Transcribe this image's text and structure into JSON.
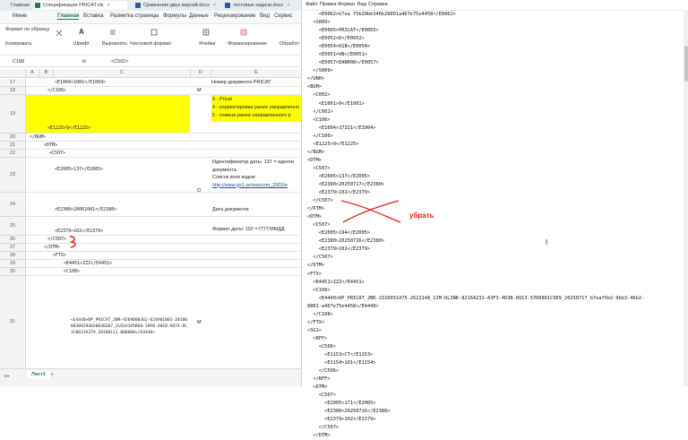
{
  "tabs": [
    {
      "label": "Главная",
      "color": ""
    },
    {
      "label": "Спецификация PRICAT.xls",
      "color": "#1f7a45",
      "active": true
    },
    {
      "label": "Сравнение двух версий.docx",
      "color": "#2b579a"
    },
    {
      "label": "тестовые задачи.docx",
      "color": "#2b579a"
    }
  ],
  "ribbon_menu": [
    "Меню",
    "Главная",
    "Вставка",
    "Разметка страницы",
    "Формулы",
    "Данные",
    "Рецензирование",
    "Вид",
    "Сервис"
  ],
  "toolbar": {
    "format_painter": "Формат по образцу",
    "copy": "Копировать",
    "font": "Шрифт",
    "align": "Выровнять",
    "number_format": "Числовой формат",
    "cells": "Ячейки",
    "conditional_format": "Форматирование",
    "process": "Обработ"
  },
  "formula_bar": {
    "cell_ref": "C188",
    "fx": "fx",
    "content": "<C502>"
  },
  "columns": [
    "A",
    "B",
    "C",
    "D",
    "E"
  ],
  "rows": [
    {
      "num": "17",
      "c": "<E1004>1001</E1004>",
      "d": "",
      "e": "Номер документа PRICAT"
    },
    {
      "num": "18",
      "c": "</C106>",
      "d": "M",
      "e": ""
    },
    {
      "num": "19",
      "c": "<E1225>9</E1225>",
      "d": "",
      "e": "",
      "e_lines": [
        "9 - Pricat",
        "4 - корректировка ранее направленно",
        "5 - отмена ранее направленного р"
      ]
    },
    {
      "num": "20",
      "c": "</BGM>",
      "d": "",
      "e": ""
    },
    {
      "num": "21",
      "c": "<DTM>",
      "d": "",
      "e": ""
    },
    {
      "num": "22",
      "c": "<C507>",
      "d": "",
      "e": ""
    },
    {
      "num": "23",
      "c": "<E2005>137</E2005>",
      "d": "",
      "e": "",
      "e_lines": [
        "Идентификатор даты. 137 = иденти",
        "документа.",
        "Список всех кодов:",
        "http://www.gs1.se/eancom_2002/e"
      ]
    },
    {
      "num": "24",
      "c": "<E2380>20061001</E2380>",
      "d": "O",
      "e": "Дата документа"
    },
    {
      "num": "25",
      "c": "<E2379>102</E2379>",
      "d": "",
      "e": "Формат даты: 102 = ГГГГММДД"
    },
    {
      "num": "26",
      "c": "</C507>",
      "d": "",
      "e": ""
    },
    {
      "num": "27",
      "c": "</DTM>",
      "d": "",
      "e": ""
    },
    {
      "num": "28",
      "c": "<FTX>",
      "d": "",
      "e": ""
    },
    {
      "num": "29",
      "c": "<E4451>ZZZ</E4451>",
      "d": "",
      "e": ""
    },
    {
      "num": "30",
      "c": "<C108>",
      "d": "",
      "e": ""
    },
    {
      "num": "31",
      "c": "<E4440>DP_PRICAT_2BM-9269000362-624901001-2018080309294020030207_2LD1A1A5B60-29FB-40CB-A074-8C1CB631A2T9_20180111_000000</E4440>",
      "d": "M",
      "e": ""
    }
  ],
  "sheet_tab": "Лист1",
  "notepad": {
    "menu": [
      "Файл",
      "Правка",
      "Формат",
      "Вид",
      "Справка"
    ],
    "lines": [
      "    <E0062>b7ea f5b29bb346b28801a467e75e4458</E0062>",
      "  <S009>",
      "    <E0065>PRICAT</E0065>",
      "    <E0052>D</E0052>",
      "    <E0054>01B</E0054>",
      "    <E0051>UN</E0051>",
      "    <E0057>EAN008</E0057>",
      "  </S009>",
      "</UNH>",
      "<BGM>",
      "  <C002>",
      "    <E1001>9</E1001>",
      "  </C002>",
      "  <C106>",
      "    <E1004>37321</E1004>",
      "  </C106>",
      "  <E1225>9</E1225>",
      "</BGM>",
      "<DTM>",
      "  <C507>",
      "    <E2005>137</E2005>",
      "    <E2380>20250717</E2380>",
      "    <E2379>102</E2379>",
      "  </C507>",
      "</DTM>",
      "<DTM>",
      "  <C507>",
      "    <E2005>194</E2005>",
      "    <E2380>20250716</E2380>",
      "    <E2379>102</E2379>",
      "  </C507>",
      "</DTM>",
      "<FTX>",
      "  <E4451>ZZZ</E4451>",
      "  <C108>",
      "    <E4440>DP_PRICAT_2BK-2310031475-2622148_2JM-DLINK-8216A231-A3F3-4D3B-8913-57D0801C9E9_20250717_b7eaf5b2-9bb3-46b2-",
      "8801-a467e75e4458</E4440>",
      "  </C108>",
      "</FTX>",
      "<SG1>",
      "  <RFF>",
      "    <C506>",
      "      <E1153>CT</E1153>",
      "      <E1154>101</E1154>",
      "    </C506>",
      "  </RFF>",
      "  <DTM>",
      "    <C507>",
      "      <E2005>171</E2005>",
      "      <E2380>20250716</E2380>",
      "      <E2379>102</E2379>",
      "    </C507>",
      "  </DTM>"
    ],
    "annotation": "убрать",
    "annotation_color": "#e0201a"
  }
}
